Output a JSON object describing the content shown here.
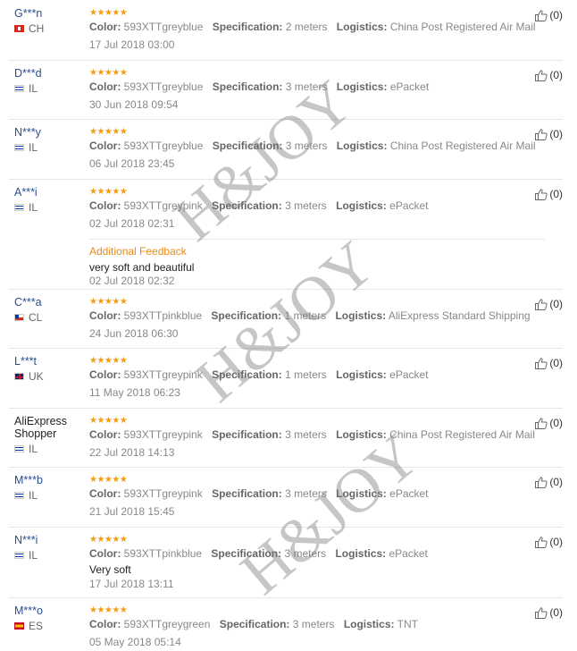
{
  "reviews": [
    {
      "user": "G***n",
      "country": "CH",
      "flag": "ch",
      "color": "593XTTgreyblue",
      "spec": "2 meters",
      "logistics": "China Post Registered Air Mail",
      "date": "17 Jul 2018 03:00",
      "helpful": "(0)"
    },
    {
      "user": "D***d",
      "country": "IL",
      "flag": "il",
      "color": "593XTTgreyblue",
      "spec": "3 meters",
      "logistics": "ePacket",
      "date": "30 Jun 2018 09:54",
      "helpful": "(0)"
    },
    {
      "user": "N***y",
      "country": "IL",
      "flag": "il",
      "color": "593XTTgreyblue",
      "spec": "3 meters",
      "logistics": "China Post Registered Air Mail",
      "date": "06 Jul 2018 23:45",
      "helpful": "(0)"
    },
    {
      "user": "A***i",
      "country": "IL",
      "flag": "il",
      "color": "593XTTgreypink",
      "spec": "3 meters",
      "logistics": "ePacket",
      "date": "02 Jul 2018 02:31",
      "helpful": "(0)",
      "additional": {
        "title": "Additional Feedback",
        "text": "very soft and beautiful",
        "date": "02 Jul 2018 02:32"
      }
    },
    {
      "user": "C***a",
      "country": "CL",
      "flag": "cl",
      "color": "593XTTpinkblue",
      "spec": "1 meters",
      "logistics": "AliExpress Standard Shipping",
      "date": "24 Jun 2018 06:30",
      "helpful": "(0)"
    },
    {
      "user": "L***t",
      "country": "UK",
      "flag": "uk",
      "color": "593XTTgreypink",
      "spec": "1 meters",
      "logistics": "ePacket",
      "date": "11 May 2018 06:23",
      "helpful": "(0)"
    },
    {
      "user": "AliExpress Shopper",
      "country": "IL",
      "flag": "il",
      "color": "593XTTgreypink",
      "spec": "3 meters",
      "logistics": "China Post Registered Air Mail",
      "date": "22 Jul 2018 14:13",
      "helpful": "(0)"
    },
    {
      "user": "M***b",
      "country": "IL",
      "flag": "il",
      "color": "593XTTgreypink",
      "spec": "3 meters",
      "logistics": "ePacket",
      "date": "21 Jul 2018 15:45",
      "helpful": "(0)"
    },
    {
      "user": "N***i",
      "country": "IL",
      "flag": "il",
      "color": "593XTTpinkblue",
      "spec": "3 meters",
      "logistics": "ePacket",
      "text": "Very soft",
      "date": "17 Jul 2018 13:11",
      "helpful": "(0)"
    },
    {
      "user": "M***o",
      "country": "ES",
      "flag": "es",
      "color": "593XTTgreygreen",
      "spec": "3 meters",
      "logistics": "TNT",
      "date": "05 May 2018 05:14",
      "helpful": "(0)"
    }
  ],
  "labels": {
    "color": "Color:",
    "spec": "Specification:",
    "logistics": "Logistics:",
    "stars": "★★★★★"
  },
  "watermark": "H&JOY",
  "colors": {
    "stars": "#f39c12",
    "username": "#2a4f8f",
    "additional_feedback": "#e88a12"
  }
}
